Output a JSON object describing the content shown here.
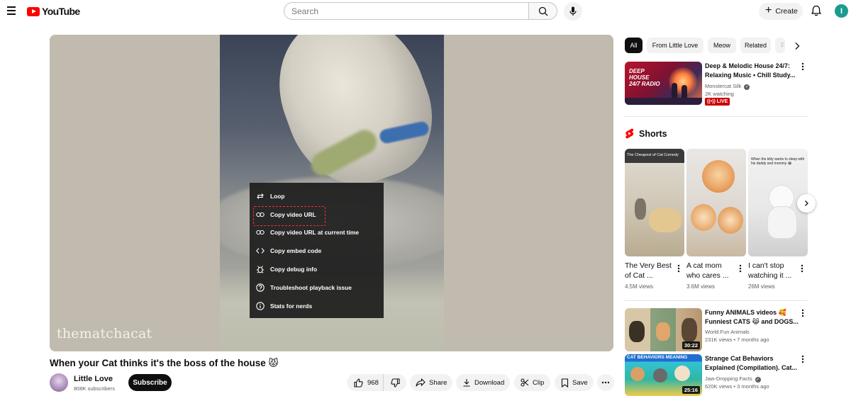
{
  "header": {
    "logo_text": "YouTube",
    "search_placeholder": "Search",
    "create_label": "Create",
    "avatar_letter": "I"
  },
  "player": {
    "watermark": "thematchacat",
    "context_menu": [
      {
        "label": "Loop",
        "icon": "loop-icon"
      },
      {
        "label": "Copy video URL",
        "icon": "link-icon",
        "highlighted": true
      },
      {
        "label": "Copy video URL at current time",
        "icon": "link-icon"
      },
      {
        "label": "Copy embed code",
        "icon": "code-icon"
      },
      {
        "label": "Copy debug info",
        "icon": "bug-icon"
      },
      {
        "label": "Troubleshoot playback issue",
        "icon": "help-icon"
      },
      {
        "label": "Stats for nerds",
        "icon": "info-icon"
      }
    ],
    "highlight_color": "#ff2b2b"
  },
  "video": {
    "title": "When your Cat thinks it's the boss of the house 😾",
    "channel_name": "Little Love",
    "subscribers": "808K subscribers",
    "subscribe_label": "Subscribe",
    "likes": "968",
    "share_label": "Share",
    "download_label": "Download",
    "clip_label": "Clip",
    "save_label": "Save"
  },
  "sidebar": {
    "chips": [
      "All",
      "From Little Love",
      "Meow",
      "Related",
      "F"
    ],
    "recommendations": [
      {
        "title": "Deep & Melodic House 24/7: Relaxing Music • Chill Study...",
        "channel": "Monstercat Silk",
        "verified": true,
        "meta": "2K watching",
        "live_label": "LIVE",
        "thumb_text": "DEEP HOUSE 24/7 RADIO"
      },
      {
        "title": "Funny ANIMALS videos 🥰 Funniest CATS 😹 and DOGS...",
        "channel": "World Fun Animals",
        "verified": false,
        "meta": "231K views • 7 months ago",
        "duration": "30:22"
      },
      {
        "title": "Strange Cat Behaviors Explained (Compilation). Cat...",
        "channel": "Jaw-Dropping Facts",
        "verified": true,
        "meta": "620K views • 3 months ago",
        "duration": "25:16",
        "thumb_text": "CAT BEHAVIORS MEANING"
      }
    ],
    "shorts_label": "Shorts",
    "shorts": [
      {
        "title": "The Very Best of Cat ...",
        "views": "4.5M views",
        "overlay": "The Cheapest of Cat Comedy"
      },
      {
        "title": "A cat mom who cares ...",
        "views": "3.6M views"
      },
      {
        "title": "I can't stop watching it ...",
        "views": "26M views",
        "overlay": "When the kitty wants to sleep with his daddy and mommy 😂"
      }
    ]
  },
  "colors": {
    "brand_red": "#ff0000",
    "live_red": "#cc0000",
    "subscribe_bg": "#0f0f0f",
    "avatar_bg": "#1a9b8e"
  }
}
